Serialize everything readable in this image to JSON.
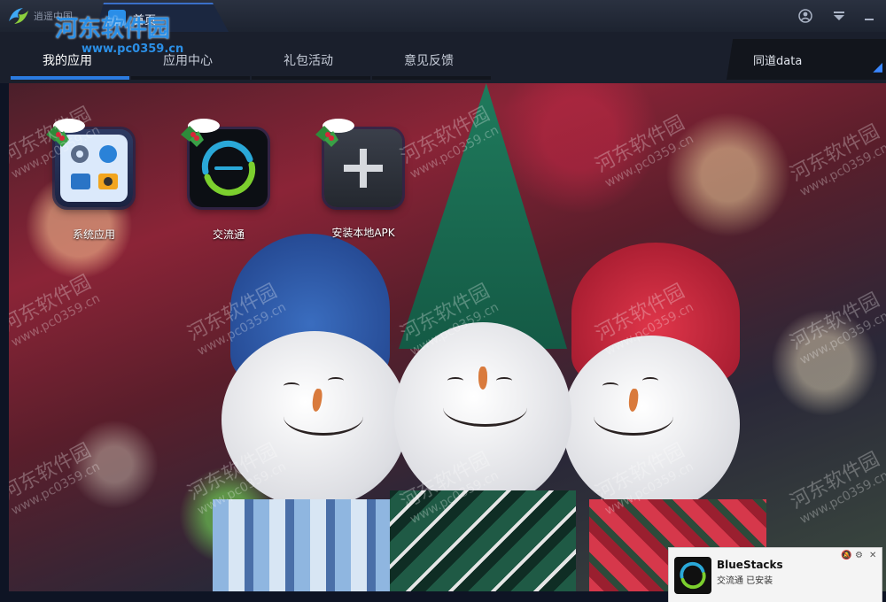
{
  "titlebar": {
    "app_name": "逍遥中国",
    "tab_label": "首页"
  },
  "nav": {
    "tabs": [
      {
        "label": "我的应用",
        "active": true
      },
      {
        "label": "应用中心",
        "active": false
      },
      {
        "label": "礼包活动",
        "active": false
      },
      {
        "label": "意见反馈",
        "active": false
      }
    ],
    "sync_label": "同道data",
    "accent_color": "#2b7be0"
  },
  "watermark": {
    "brand": "河东软件园",
    "url": "www.pc0359.cn"
  },
  "desktop": {
    "apps": [
      {
        "label": "系统应用",
        "icon": "system-apps-icon"
      },
      {
        "label": "交流通",
        "icon": "jiaoliutong-icon"
      },
      {
        "label": "安装本地APK",
        "icon": "add-icon"
      }
    ]
  },
  "notification": {
    "title": "BlueStacks",
    "message": "交流通 已安装"
  }
}
